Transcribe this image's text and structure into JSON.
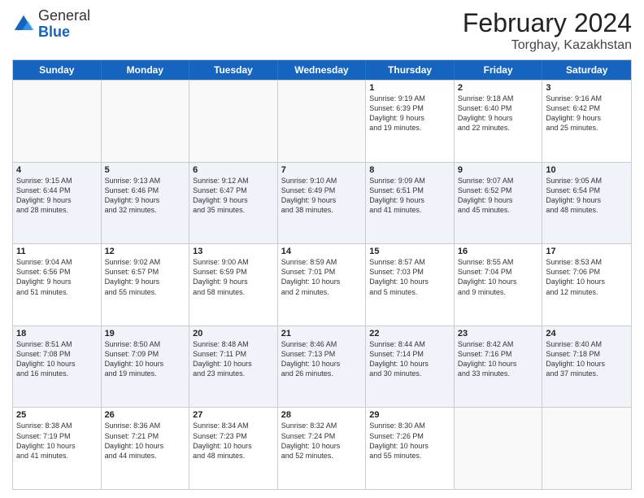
{
  "header": {
    "logo": {
      "general": "General",
      "blue": "Blue"
    },
    "title": "February 2024",
    "subtitle": "Torghay, Kazakhstan"
  },
  "calendar": {
    "days": [
      "Sunday",
      "Monday",
      "Tuesday",
      "Wednesday",
      "Thursday",
      "Friday",
      "Saturday"
    ],
    "rows": [
      [
        {
          "day": "",
          "info": "",
          "empty": true
        },
        {
          "day": "",
          "info": "",
          "empty": true
        },
        {
          "day": "",
          "info": "",
          "empty": true
        },
        {
          "day": "",
          "info": "",
          "empty": true
        },
        {
          "day": "1",
          "info": "Sunrise: 9:19 AM\nSunset: 6:39 PM\nDaylight: 9 hours\nand 19 minutes."
        },
        {
          "day": "2",
          "info": "Sunrise: 9:18 AM\nSunset: 6:40 PM\nDaylight: 9 hours\nand 22 minutes."
        },
        {
          "day": "3",
          "info": "Sunrise: 9:16 AM\nSunset: 6:42 PM\nDaylight: 9 hours\nand 25 minutes."
        }
      ],
      [
        {
          "day": "4",
          "info": "Sunrise: 9:15 AM\nSunset: 6:44 PM\nDaylight: 9 hours\nand 28 minutes."
        },
        {
          "day": "5",
          "info": "Sunrise: 9:13 AM\nSunset: 6:46 PM\nDaylight: 9 hours\nand 32 minutes."
        },
        {
          "day": "6",
          "info": "Sunrise: 9:12 AM\nSunset: 6:47 PM\nDaylight: 9 hours\nand 35 minutes."
        },
        {
          "day": "7",
          "info": "Sunrise: 9:10 AM\nSunset: 6:49 PM\nDaylight: 9 hours\nand 38 minutes."
        },
        {
          "day": "8",
          "info": "Sunrise: 9:09 AM\nSunset: 6:51 PM\nDaylight: 9 hours\nand 41 minutes."
        },
        {
          "day": "9",
          "info": "Sunrise: 9:07 AM\nSunset: 6:52 PM\nDaylight: 9 hours\nand 45 minutes."
        },
        {
          "day": "10",
          "info": "Sunrise: 9:05 AM\nSunset: 6:54 PM\nDaylight: 9 hours\nand 48 minutes."
        }
      ],
      [
        {
          "day": "11",
          "info": "Sunrise: 9:04 AM\nSunset: 6:56 PM\nDaylight: 9 hours\nand 51 minutes."
        },
        {
          "day": "12",
          "info": "Sunrise: 9:02 AM\nSunset: 6:57 PM\nDaylight: 9 hours\nand 55 minutes."
        },
        {
          "day": "13",
          "info": "Sunrise: 9:00 AM\nSunset: 6:59 PM\nDaylight: 9 hours\nand 58 minutes."
        },
        {
          "day": "14",
          "info": "Sunrise: 8:59 AM\nSunset: 7:01 PM\nDaylight: 10 hours\nand 2 minutes."
        },
        {
          "day": "15",
          "info": "Sunrise: 8:57 AM\nSunset: 7:03 PM\nDaylight: 10 hours\nand 5 minutes."
        },
        {
          "day": "16",
          "info": "Sunrise: 8:55 AM\nSunset: 7:04 PM\nDaylight: 10 hours\nand 9 minutes."
        },
        {
          "day": "17",
          "info": "Sunrise: 8:53 AM\nSunset: 7:06 PM\nDaylight: 10 hours\nand 12 minutes."
        }
      ],
      [
        {
          "day": "18",
          "info": "Sunrise: 8:51 AM\nSunset: 7:08 PM\nDaylight: 10 hours\nand 16 minutes."
        },
        {
          "day": "19",
          "info": "Sunrise: 8:50 AM\nSunset: 7:09 PM\nDaylight: 10 hours\nand 19 minutes."
        },
        {
          "day": "20",
          "info": "Sunrise: 8:48 AM\nSunset: 7:11 PM\nDaylight: 10 hours\nand 23 minutes."
        },
        {
          "day": "21",
          "info": "Sunrise: 8:46 AM\nSunset: 7:13 PM\nDaylight: 10 hours\nand 26 minutes."
        },
        {
          "day": "22",
          "info": "Sunrise: 8:44 AM\nSunset: 7:14 PM\nDaylight: 10 hours\nand 30 minutes."
        },
        {
          "day": "23",
          "info": "Sunrise: 8:42 AM\nSunset: 7:16 PM\nDaylight: 10 hours\nand 33 minutes."
        },
        {
          "day": "24",
          "info": "Sunrise: 8:40 AM\nSunset: 7:18 PM\nDaylight: 10 hours\nand 37 minutes."
        }
      ],
      [
        {
          "day": "25",
          "info": "Sunrise: 8:38 AM\nSunset: 7:19 PM\nDaylight: 10 hours\nand 41 minutes."
        },
        {
          "day": "26",
          "info": "Sunrise: 8:36 AM\nSunset: 7:21 PM\nDaylight: 10 hours\nand 44 minutes."
        },
        {
          "day": "27",
          "info": "Sunrise: 8:34 AM\nSunset: 7:23 PM\nDaylight: 10 hours\nand 48 minutes."
        },
        {
          "day": "28",
          "info": "Sunrise: 8:32 AM\nSunset: 7:24 PM\nDaylight: 10 hours\nand 52 minutes."
        },
        {
          "day": "29",
          "info": "Sunrise: 8:30 AM\nSunset: 7:26 PM\nDaylight: 10 hours\nand 55 minutes."
        },
        {
          "day": "",
          "info": "",
          "empty": true
        },
        {
          "day": "",
          "info": "",
          "empty": true
        }
      ]
    ]
  }
}
